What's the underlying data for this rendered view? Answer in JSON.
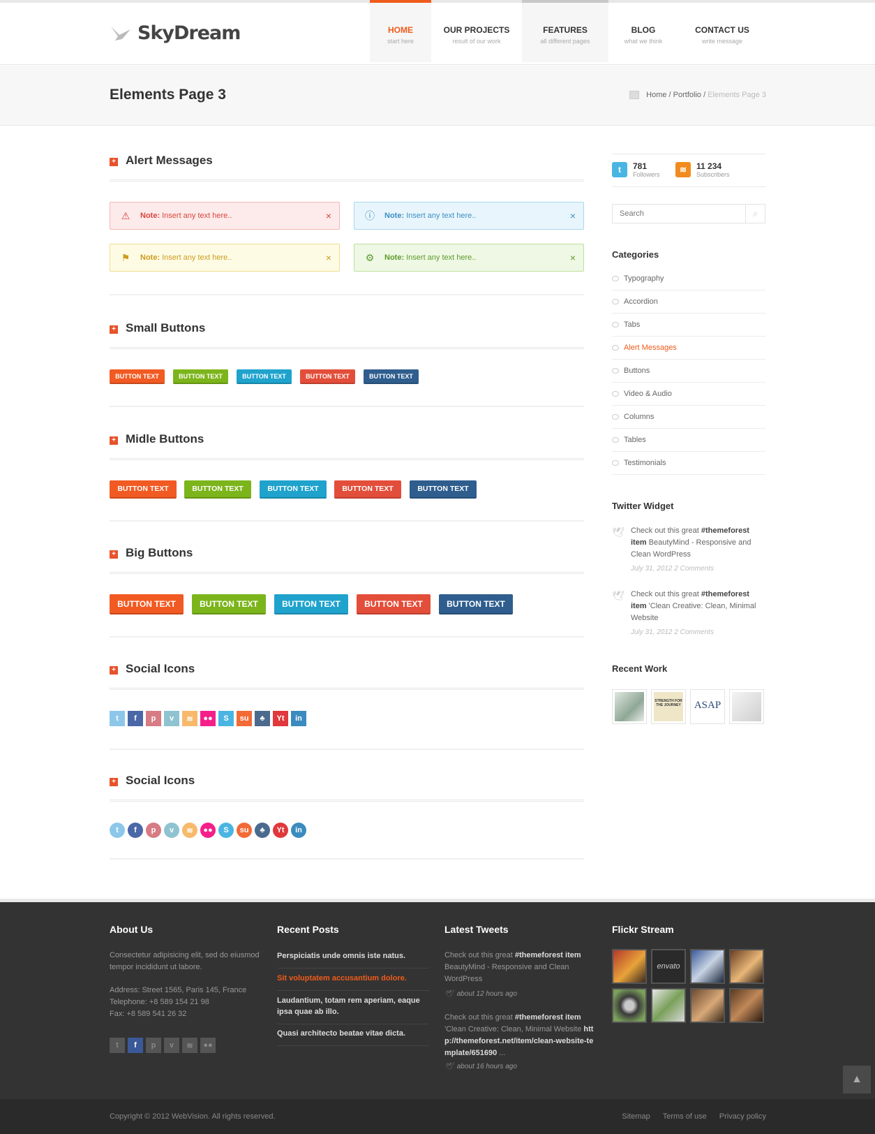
{
  "header": {
    "logo_text": "SkyDream",
    "nav": [
      {
        "title": "HOME",
        "sub": "start here"
      },
      {
        "title": "OUR PROJECTS",
        "sub": "result of our work"
      },
      {
        "title": "FEATURES",
        "sub": "all different pages"
      },
      {
        "title": "BLOG",
        "sub": "what we think"
      },
      {
        "title": "CONTACT US",
        "sub": "write message"
      }
    ]
  },
  "titlebar": {
    "title": "Elements Page 3",
    "crumbs": [
      "Home",
      "Portfolio",
      "Elements Page 3"
    ],
    "crumb_sep": "/"
  },
  "sections": {
    "alerts": "Alert Messages",
    "small_buttons": "Small Buttons",
    "midle_buttons": "Midle Buttons",
    "big_buttons": "Big Buttons",
    "social_square": "Social Icons",
    "social_round": "Social Icons"
  },
  "alerts": [
    {
      "type": "error",
      "note": "Note:",
      "text": "Insert any text here..",
      "close": "×"
    },
    {
      "type": "info",
      "note": "Note:",
      "text": "Insert any text here..",
      "close": "×"
    },
    {
      "type": "warning",
      "note": "Note:",
      "text": "Insert any text here..",
      "close": "×"
    },
    {
      "type": "success",
      "note": "Note:",
      "text": "Insert any text here..",
      "close": "×"
    }
  ],
  "buttons": {
    "label": "BUTTON TEXT",
    "colors": [
      "#f15a22",
      "#7cb51b",
      "#1fa3cd",
      "#e34e3a",
      "#2f5e8e"
    ]
  },
  "social_icons": [
    {
      "name": "twitter",
      "glyph": "t",
      "color": "#8cc7ea"
    },
    {
      "name": "facebook",
      "glyph": "f",
      "color": "#4a67a8"
    },
    {
      "name": "pinterest",
      "glyph": "p",
      "color": "#d77b85"
    },
    {
      "name": "vimeo",
      "glyph": "v",
      "color": "#8fc3d1"
    },
    {
      "name": "rss",
      "glyph": "≋",
      "color": "#f7b96b"
    },
    {
      "name": "flickr",
      "glyph": "●●",
      "color": "#f51f8a"
    },
    {
      "name": "skype",
      "glyph": "S",
      "color": "#4ab5e3"
    },
    {
      "name": "stumbleupon",
      "glyph": "su",
      "color": "#f26a36"
    },
    {
      "name": "myspace",
      "glyph": "♣",
      "color": "#4b6a8e"
    },
    {
      "name": "youtube",
      "glyph": "Yt",
      "color": "#e0383c"
    },
    {
      "name": "linkedin",
      "glyph": "in",
      "color": "#3b8bbf"
    }
  ],
  "sidebar": {
    "twitter": {
      "count": "781",
      "label": "Followers"
    },
    "rss": {
      "count": "11 234",
      "label": "Subscribers"
    },
    "search_placeholder": "Search",
    "categories_title": "Categories",
    "categories": [
      "Typography",
      "Accordion",
      "Tabs",
      "Alert Messages",
      "Buttons",
      "Video & Audio",
      "Columns",
      "Tables",
      "Testimonials"
    ],
    "twitter_widget_title": "Twitter Widget",
    "tweets": [
      {
        "pre": "Check out this great ",
        "tag": "#themeforest item",
        "rest": " BeautyMind - Responsive and Clean WordPress",
        "date": "July 31, 2012 2 Comments"
      },
      {
        "pre": "Check out this great ",
        "tag": "#themeforest item",
        "rest": " 'Clean Creative: Clean, Minimal Website",
        "date": "July 31, 2012 2 Comments"
      }
    ],
    "recent_work_title": "Recent Work",
    "recent_work_labels": [
      "",
      "STRENGTH FOR THE JOURNEY",
      "ASAP",
      ""
    ]
  },
  "footer": {
    "about_title": "About Us",
    "about_text": "Consectetur adipisicing elit, sed do eiusmod tempor incididunt ut labore.",
    "address": "Address: Street 1565, Paris 145, France",
    "telephone": "Telephone: +8 589 154 21 98",
    "fax": "Fax: +8 589 541 26 32",
    "posts_title": "Recent Posts",
    "posts": [
      "Perspiciatis unde omnis iste natus.",
      "Sit voluptatem accusantium dolore.",
      "Laudantium, totam rem aperiam, eaque ipsa quae ab illo.",
      "Quasi architecto beatae vitae dicta."
    ],
    "tweets_title": "Latest Tweets",
    "tweets": [
      {
        "pre": "Check out this great ",
        "tag": "#themeforest item",
        "rest": " BeautyMind - Responsive and Clean WordPress",
        "link": "",
        "date": "about 12 hours ago"
      },
      {
        "pre": "Check out this great ",
        "tag": "#themeforest item",
        "rest": " 'Clean Creative: Clean, Minimal Website ",
        "link": "http://themeforest.net/item/clean-website-template/651690",
        "tail": " ...",
        "date": "about 16 hours ago"
      }
    ],
    "flickr_title": "Flickr Stream",
    "flickr_label": "envato",
    "copyright": "Copyright © 2012 WebVision. All rights reserved.",
    "links": [
      "Sitemap",
      "Terms of use",
      "Privacy policy"
    ]
  },
  "colors": {
    "accent": "#ef5b1a",
    "footer": "#333333"
  },
  "totop_glyph": "▲"
}
